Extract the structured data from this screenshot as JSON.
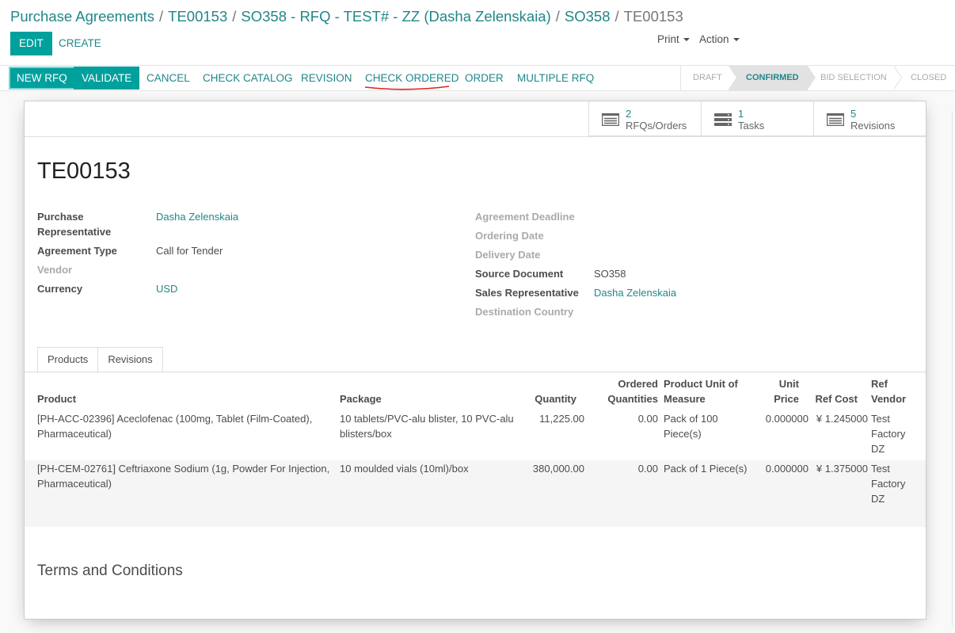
{
  "breadcrumb": {
    "items": [
      "Purchase Agreements",
      "TE00153",
      "SO358 - RFQ - TEST# - ZZ (Dasha Zelenskaia)",
      "SO358"
    ],
    "separator": "/",
    "current": "TE00153"
  },
  "toolbar": {
    "edit_label": "EDIT",
    "create_label": "CREATE",
    "print_label": "Print",
    "action_label": "Action"
  },
  "statusbar": {
    "buttons": {
      "new_rfq": "NEW RFQ",
      "validate": "VALIDATE",
      "cancel": "CANCEL",
      "check_catalog": "CHECK CATALOG",
      "revision": "REVISION",
      "check_ordered": "CHECK ORDERED",
      "order": "ORDER",
      "multiple_rfq": "MULTIPLE RFQ"
    },
    "stages": [
      "DRAFT",
      "CONFIRMED",
      "BID SELECTION",
      "CLOSED"
    ],
    "current_stage": "CONFIRMED"
  },
  "smart_buttons": {
    "rfqs": {
      "value": "2",
      "label": "RFQs/Orders"
    },
    "tasks": {
      "value": "1",
      "label": "Tasks"
    },
    "revisions": {
      "value": "5",
      "label": "Revisions"
    }
  },
  "record": {
    "name": "TE00153",
    "left": {
      "purchase_rep_label_1": "Purchase",
      "purchase_rep_label_2": "Representative",
      "purchase_rep": "Dasha Zelenskaia",
      "agreement_type_label": "Agreement Type",
      "agreement_type": "Call for Tender",
      "vendor_label": "Vendor",
      "currency_label": "Currency",
      "currency": "USD"
    },
    "right": {
      "deadline_label": "Agreement Deadline",
      "ordering_date_label": "Ordering Date",
      "delivery_date_label": "Delivery Date",
      "source_doc_label": "Source Document",
      "source_doc": "SO358",
      "sales_rep_label": "Sales Representative",
      "sales_rep": "Dasha Zelenskaia",
      "dest_country_label": "Destination Country"
    }
  },
  "tabs": [
    "Products",
    "Revisions"
  ],
  "products_table": {
    "headers": {
      "product": "Product",
      "package": "Package",
      "quantity": "Quantity",
      "ordered_1": "Ordered",
      "ordered_2": "Quantities",
      "uom_1": "Product Unit of",
      "uom_2": "Measure",
      "unit_price_1": "Unit",
      "unit_price_2": "Price",
      "ref_cost": "Ref Cost",
      "ref_vendor_1": "Ref",
      "ref_vendor_2": "Vendor"
    },
    "rows": [
      {
        "product_1": "[PH-ACC-02396] Aceclofenac (100mg, Tablet (Film-Coated),",
        "product_2": "Pharmaceutical)",
        "package_1": "10 tablets/PVC-alu blister, 10 PVC-alu",
        "package_2": "blisters/box",
        "quantity": "11,225.00",
        "ordered": "0.00",
        "uom_1": "Pack of 100",
        "uom_2": "Piece(s)",
        "unit_price": "0.000000",
        "ref_cost": "¥ 1.245000",
        "vendor_1": "Test",
        "vendor_2": "Factory",
        "vendor_3": "DZ"
      },
      {
        "product_1": "[PH-CEM-02761] Ceftriaxone Sodium (1g, Powder For Injection,",
        "product_2": "Pharmaceutical)",
        "package_1": "10 moulded vials (10ml)/box",
        "package_2": "",
        "quantity": "380,000.00",
        "ordered": "0.00",
        "uom_1": "Pack of 1 Piece(s)",
        "uom_2": "",
        "unit_price": "0.000000",
        "ref_cost": "¥ 1.375000",
        "vendor_1": "Test",
        "vendor_2": "Factory",
        "vendor_3": "DZ"
      }
    ]
  },
  "terms_label": "Terms and Conditions",
  "colors": {
    "primary": "#00A09D",
    "link": "#21868a",
    "annotation_underline": "#e0221b"
  }
}
